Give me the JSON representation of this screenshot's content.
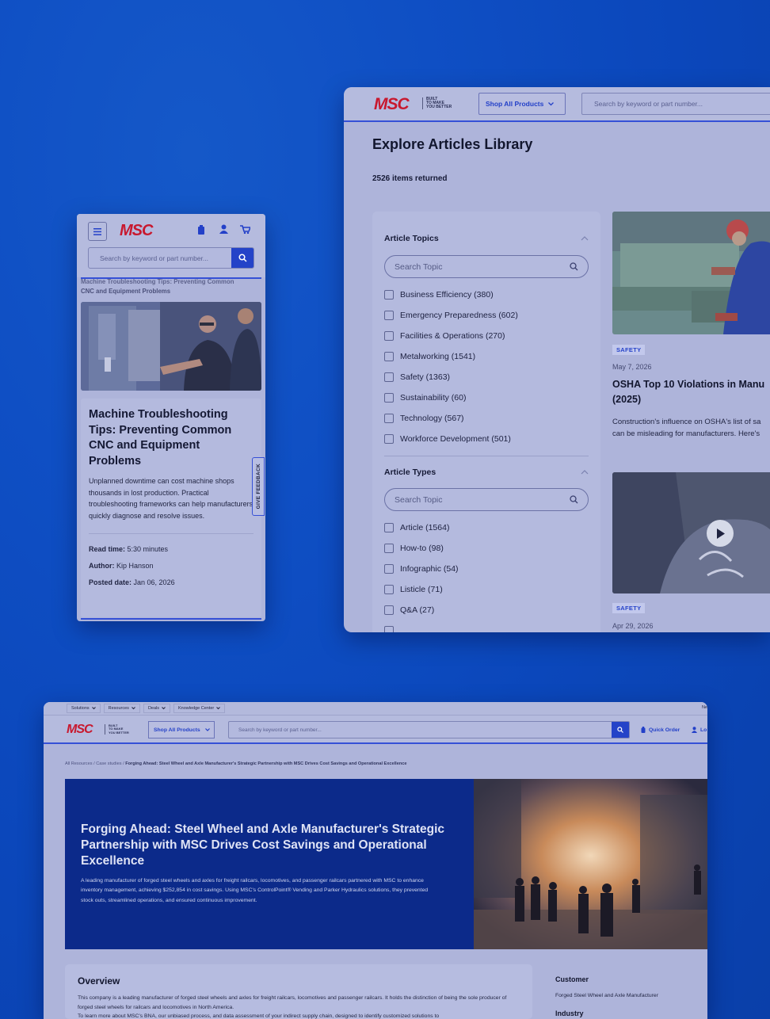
{
  "mobile": {
    "logo": "MSC",
    "search_placeholder": "Search by keyword or part number...",
    "breadcrumb_line1": "Machine Troubleshooting Tips: Preventing Common",
    "breadcrumb_line2": "CNC and Equipment Problems",
    "title": "Machine Troubleshooting Tips: Preventing Common CNC and Equipment Problems",
    "summary": "Unplanned downtime can cost machine shops thousands in lost production. Practical troubleshooting frameworks can help manufacturers quickly diagnose and resolve issues.",
    "feedback": "GIVE FEEDBACK",
    "read_time_label": "Read time:",
    "read_time": "5:30 minutes",
    "author_label": "Author:",
    "author": "Kip Hanson",
    "posted_label": "Posted date:",
    "posted": "Jan 06, 2026"
  },
  "library": {
    "logo": "MSC",
    "tagline": [
      "BUILT",
      "TO MAKE",
      "YOU BETTER"
    ],
    "shop_all": "Shop All Products",
    "search_placeholder": "Search by keyword or part number...",
    "title": "Explore Articles Library",
    "count": "2526 items returned",
    "topics_heading": "Article Topics",
    "topics_search": "Search Topic",
    "topics": [
      "Business Efficiency (380)",
      "Emergency Preparedness (602)",
      "Facilities & Operations (270)",
      "Metalworking (1541)",
      "Safety (1363)",
      "Sustainability (60)",
      "Technology (567)",
      "Workforce Development (501)"
    ],
    "types_heading": "Article Types",
    "types_search": "Search Topic",
    "types": [
      "Article (1564)",
      "How-to (98)",
      "Infographic (54)",
      "Listicle (71)",
      "Q&A (27)"
    ],
    "card1": {
      "badge": "SAFETY",
      "date": "May 7, 2026",
      "title_line1": "OSHA Top 10 Violations in Manu",
      "title_line2": "(2025)",
      "desc_line1": "Construction's influence on OSHA's list of sa",
      "desc_line2": "can be misleading for manufacturers. Here's"
    },
    "card2": {
      "badge": "SAFETY",
      "date": "Apr 29, 2026"
    }
  },
  "casestudy": {
    "nav": [
      "Solutions",
      "Resources",
      "Deals",
      "Knowledge Center"
    ],
    "nav_right": "Ne",
    "logo": "MSC",
    "tagline": [
      "BUILT",
      "TO MAKE",
      "YOU BETTER"
    ],
    "shop_all": "Shop All Products",
    "search_placeholder": "Search by keyword or part number...",
    "quick_order": "Quick Order",
    "login": "Lo",
    "breadcrumb_a": "All Resources",
    "breadcrumb_b": "Case studies",
    "breadcrumb_c": "Forging Ahead: Steel Wheel and Axle Manufacturer's Strategic Partnership with MSC Drives Cost Savings and Operational Excellence",
    "hero_title": "Forging Ahead: Steel Wheel and Axle Manufacturer's Strategic Partnership with MSC Drives Cost Savings and Operational Excellence",
    "hero_desc": "A leading manufacturer of forged steel wheels and axles for freight railcars, locomotives, and passenger railcars partnered with MSC to enhance inventory management, achieving $252,854 in cost savings. Using MSC's ControlPoint® Vending and Parker Hydraulics solutions, they prevented stock outs, streamlined operations, and ensured continuous improvement.",
    "overview_heading": "Overview",
    "overview_text": "This company is a leading manufacturer of forged steel wheels and axles for freight railcars, locomotives and passenger railcars. It holds the distinction of being the sole producer of forged steel wheels for railcars and locomotives in North America.",
    "overview_text2": "To learn more about MSC's BNA, our unbiased process, and data assessment of your indirect supply chain, designed to identify customized solutions to",
    "customer_label": "Customer",
    "customer_value": "Forged Steel Wheel and Axle Manufacturer",
    "industry_label": "Industry"
  }
}
